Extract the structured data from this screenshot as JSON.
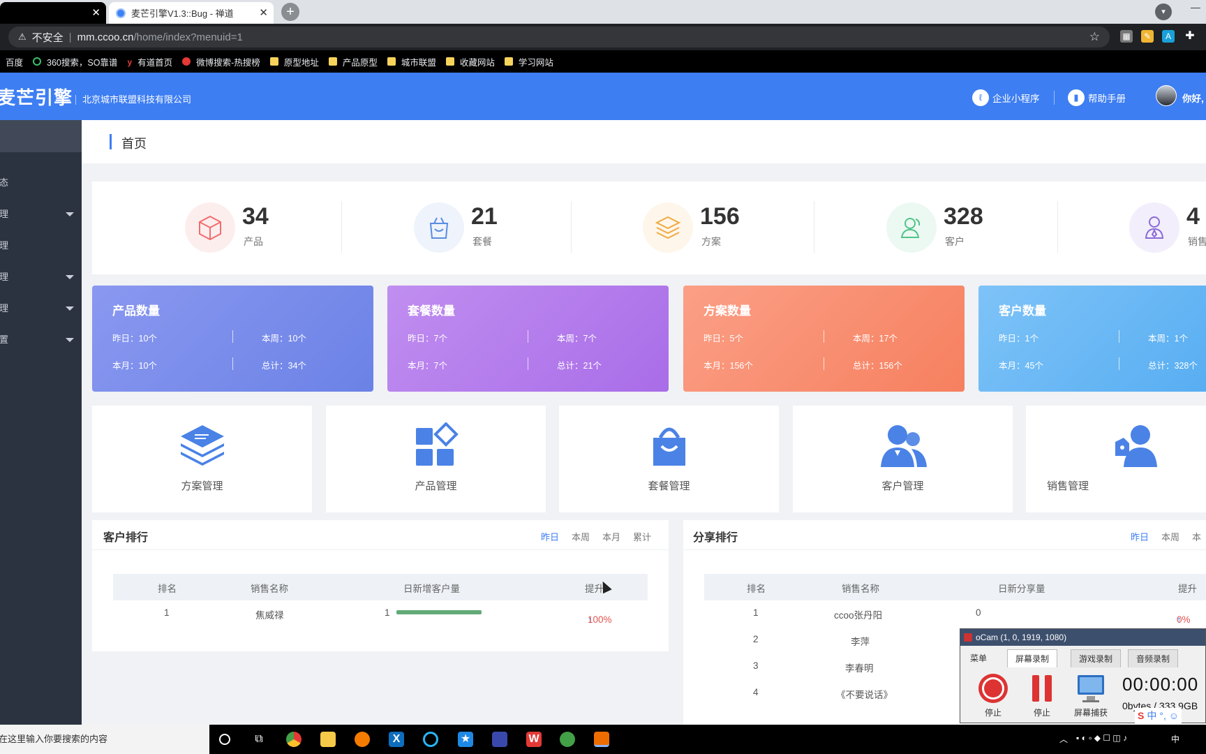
{
  "browser": {
    "tabs": [
      {
        "label": ""
      },
      {
        "label": "麦芒引擎V1.3::Bug - 禅道"
      }
    ],
    "address": {
      "security": "不安全",
      "host": "mm.ccoo.cn",
      "path": "/home/index?menuid=1"
    },
    "bookmarks": [
      {
        "label": "百度",
        "icon": "baidu-icon"
      },
      {
        "label": "360搜索，SO靠谱",
        "icon": "360-icon"
      },
      {
        "label": "有道首页",
        "icon": "youdao-icon"
      },
      {
        "label": "微博搜索-热搜榜",
        "icon": "weibo-icon"
      },
      {
        "label": "原型地址",
        "icon": "folder-icon"
      },
      {
        "label": "产品原型",
        "icon": "folder-icon"
      },
      {
        "label": "城市联盟",
        "icon": "folder-icon"
      },
      {
        "label": "收藏网站",
        "icon": "folder-icon"
      },
      {
        "label": "学习网站",
        "icon": "folder-icon"
      }
    ]
  },
  "header": {
    "logo": "麦芒引擎",
    "company": "北京城市联盟科技有限公司",
    "mini_program": "企业小程序",
    "help": "帮助手册",
    "greeting": "你好,",
    "color": "#3d7ef3"
  },
  "sidebar": {
    "items": [
      {
        "label": "态",
        "arrow": false
      },
      {
        "label": "理",
        "arrow": true
      },
      {
        "label": "理",
        "arrow": false
      },
      {
        "label": "理",
        "arrow": true
      },
      {
        "label": "理",
        "arrow": true
      },
      {
        "label": "置",
        "arrow": true
      }
    ]
  },
  "page": {
    "title": "首页"
  },
  "stats": [
    {
      "value": "34",
      "label": "产品",
      "icon": "cube-icon",
      "color": "#f26d6d",
      "bg": "#fdeeee"
    },
    {
      "value": "21",
      "label": "套餐",
      "icon": "bag-icon",
      "color": "#5a8de0",
      "bg": "#eef3fc"
    },
    {
      "value": "156",
      "label": "方案",
      "icon": "layers-icon",
      "color": "#f1a940",
      "bg": "#fef6ea"
    },
    {
      "value": "328",
      "label": "客户",
      "icon": "customer-icon",
      "color": "#52c38a",
      "bg": "#ecf9f2"
    },
    {
      "value": "4",
      "label": "销售",
      "icon": "sales-icon",
      "color": "#8a6bd6",
      "bg": "#f2eefc"
    }
  ],
  "count_cards": [
    {
      "title": "产品数量",
      "yesterday": "昨日：10个",
      "week": "本周：10个",
      "month": "本月：10个",
      "total": "总计：34个"
    },
    {
      "title": "套餐数量",
      "yesterday": "昨日：7个",
      "week": "本周：7个",
      "month": "本月：7个",
      "total": "总计：21个"
    },
    {
      "title": "方案数量",
      "yesterday": "昨日：5个",
      "week": "本周：17个",
      "month": "本月：156个",
      "total": "总计：156个"
    },
    {
      "title": "客户数量",
      "yesterday": "昨日：1个",
      "week": "本周：1个",
      "month": "本月：45个",
      "total": "总计：328个"
    }
  ],
  "modules": [
    {
      "label": "方案管理",
      "icon": "stack-icon"
    },
    {
      "label": "产品管理",
      "icon": "apps-icon"
    },
    {
      "label": "套餐管理",
      "icon": "shopping-bag-icon"
    },
    {
      "label": "客户管理",
      "icon": "users-icon"
    },
    {
      "label": "销售管理",
      "icon": "salesperson-icon"
    }
  ],
  "customer_rank": {
    "title": "客户排行",
    "tabs": [
      "昨日",
      "本周",
      "本月",
      "累计"
    ],
    "columns": [
      "排名",
      "销售名称",
      "日新增客户量",
      "提升"
    ],
    "rows": [
      {
        "rank": "1",
        "name": "焦威禄",
        "count": "1",
        "bar_fraction": 1.0,
        "lift": "100%"
      }
    ]
  },
  "share_rank": {
    "title": "分享排行",
    "tabs": [
      "昨日",
      "本周",
      "本"
    ],
    "columns": [
      "排名",
      "销售名称",
      "日新分享量",
      "提升"
    ],
    "rows": [
      {
        "rank": "1",
        "name": "ccoo张丹阳",
        "count": "0",
        "lift": "0%"
      },
      {
        "rank": "2",
        "name": "李萍",
        "count": "",
        "lift": ""
      },
      {
        "rank": "3",
        "name": "李春明",
        "count": "",
        "lift": ""
      },
      {
        "rank": "4",
        "name": "《不要说话》",
        "count": "",
        "lift": ""
      }
    ]
  },
  "ocam": {
    "title": "oCam (1, 0, 1919, 1080)",
    "tabs": [
      "菜单",
      "屏幕录制",
      "游戏录制",
      "音频录制"
    ],
    "buttons": [
      "停止",
      "停止",
      "屏幕捕获"
    ],
    "time": "00:00:00",
    "size": "0bytes / 333.9GB"
  },
  "taskbar": {
    "search_placeholder": "在这里输入你要搜索的内容",
    "ime": "中"
  }
}
